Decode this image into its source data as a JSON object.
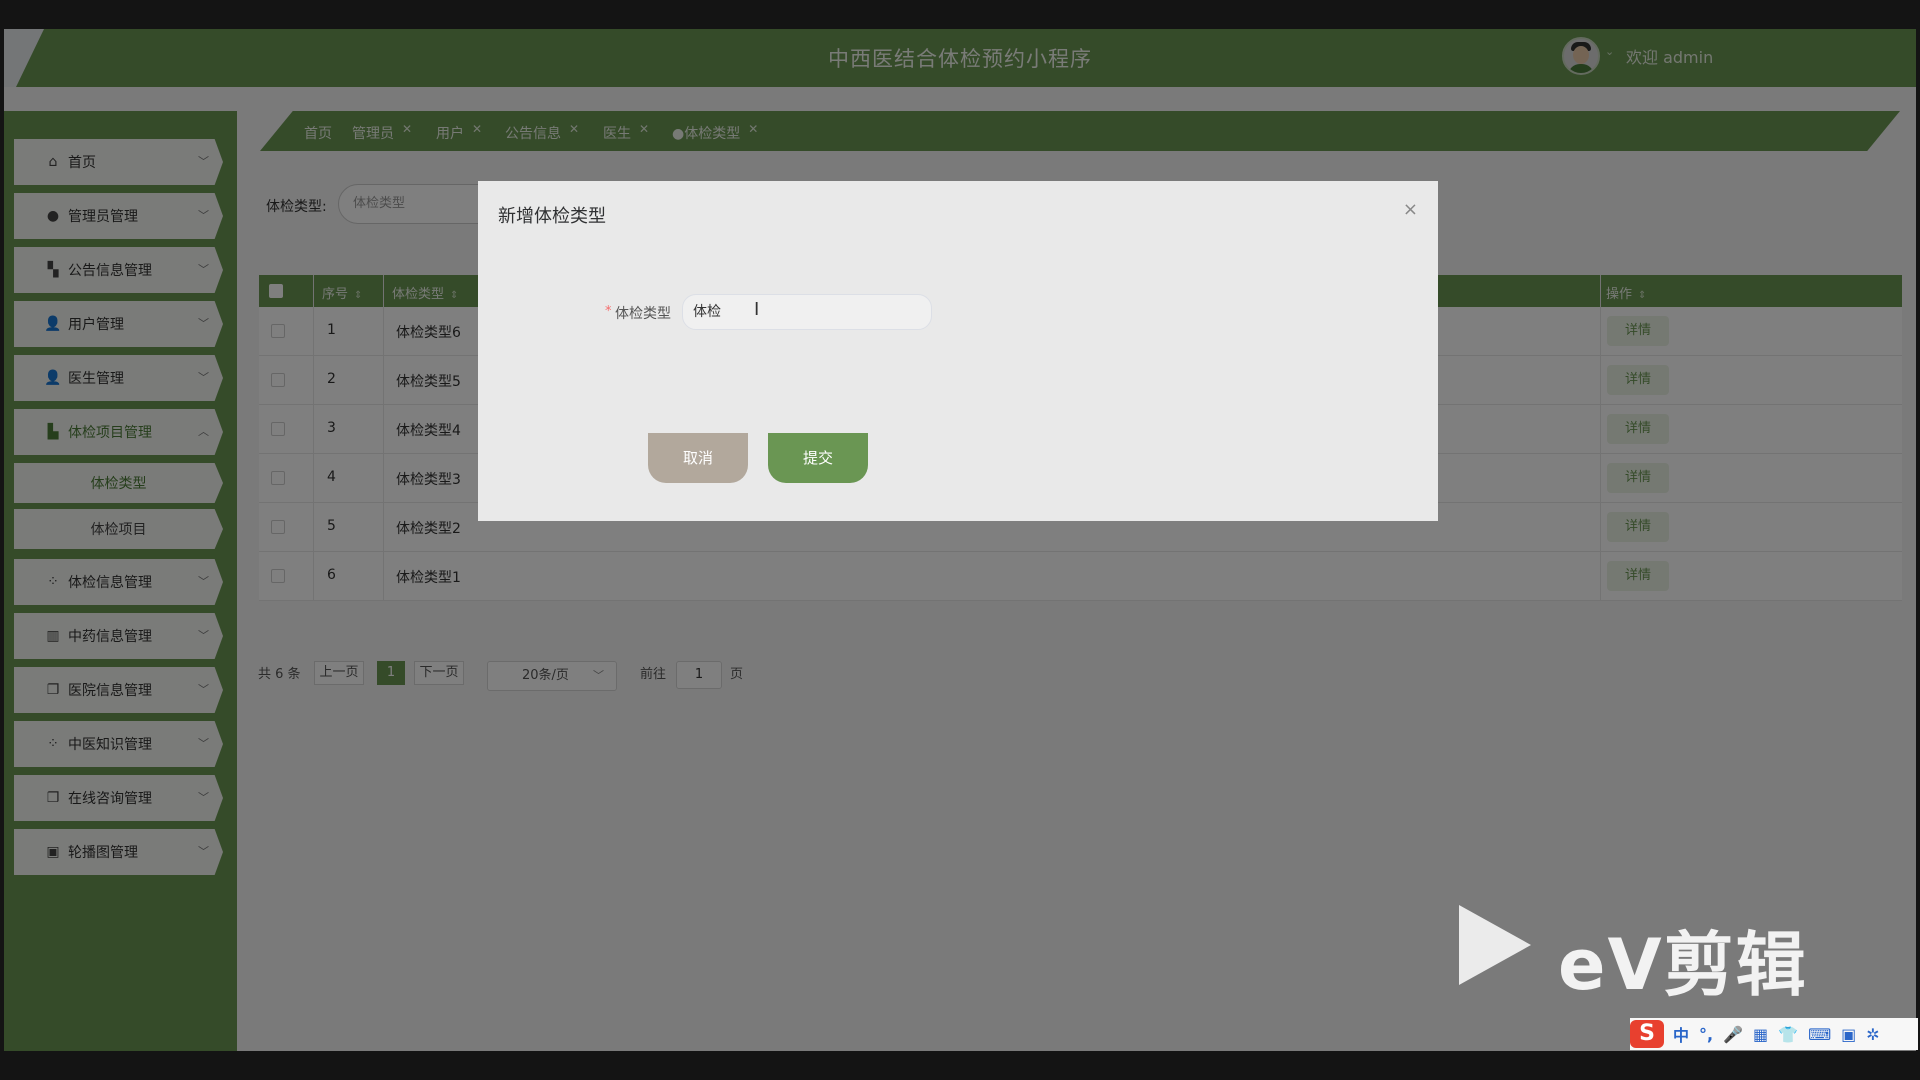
{
  "header": {
    "title": "中西医结合体检预约小程序",
    "welcome": "欢迎 admin"
  },
  "sidebar": {
    "items": [
      {
        "label": "首页",
        "icon": "home-icon"
      },
      {
        "label": "管理员管理",
        "icon": "drop-icon"
      },
      {
        "label": "公告信息管理",
        "icon": "grid-icon"
      },
      {
        "label": "用户管理",
        "icon": "user-icon"
      },
      {
        "label": "医生管理",
        "icon": "user-icon"
      },
      {
        "label": "体检项目管理",
        "icon": "book-icon"
      },
      {
        "label": "体检信息管理",
        "icon": "apps-icon"
      },
      {
        "label": "中药信息管理",
        "icon": "chart-icon"
      },
      {
        "label": "医院信息管理",
        "icon": "copy-icon"
      },
      {
        "label": "中医知识管理",
        "icon": "apps-icon"
      },
      {
        "label": "在线咨询管理",
        "icon": "copy-icon"
      },
      {
        "label": "轮播图管理",
        "icon": "image-icon"
      }
    ],
    "subitems": [
      {
        "label": "体检类型"
      },
      {
        "label": "体检项目"
      }
    ]
  },
  "tabs": [
    {
      "label": "首页"
    },
    {
      "label": "管理员"
    },
    {
      "label": "用户"
    },
    {
      "label": "公告信息"
    },
    {
      "label": "医生"
    },
    {
      "label": "●体检类型"
    }
  ],
  "filter": {
    "label": "体检类型:",
    "placeholder": "体检类型"
  },
  "table": {
    "headers": {
      "index": "序号",
      "type": "体检类型",
      "action": "操作"
    },
    "rows": [
      {
        "index": "1",
        "name": "体检类型6",
        "action": "详情"
      },
      {
        "index": "2",
        "name": "体检类型5",
        "action": "详情"
      },
      {
        "index": "3",
        "name": "体检类型4",
        "action": "详情"
      },
      {
        "index": "4",
        "name": "体检类型3",
        "action": "详情"
      },
      {
        "index": "5",
        "name": "体检类型2",
        "action": "详情"
      },
      {
        "index": "6",
        "name": "体检类型1",
        "action": "详情"
      }
    ]
  },
  "pagination": {
    "total": "共 6 条",
    "prev": "上一页",
    "current": "1",
    "next": "下一页",
    "page_size": "20条/页",
    "goto_label": "前往",
    "goto_value": "1",
    "page_unit": "页"
  },
  "modal": {
    "title": "新增体检类型",
    "required_mark": "*",
    "field_label": "体检类型",
    "field_value": "体检",
    "cancel": "取消",
    "submit": "提交",
    "close": "×"
  },
  "watermark": {
    "text": "eV剪辑"
  },
  "ime": {
    "lang": "中",
    "items": [
      "°,",
      "🎤",
      "▦",
      "👕",
      "⌨",
      "▣",
      "✲"
    ]
  },
  "colors": {
    "primary": "#6a9653",
    "cancel": "#b2a89c",
    "required": "#f56c6c"
  }
}
